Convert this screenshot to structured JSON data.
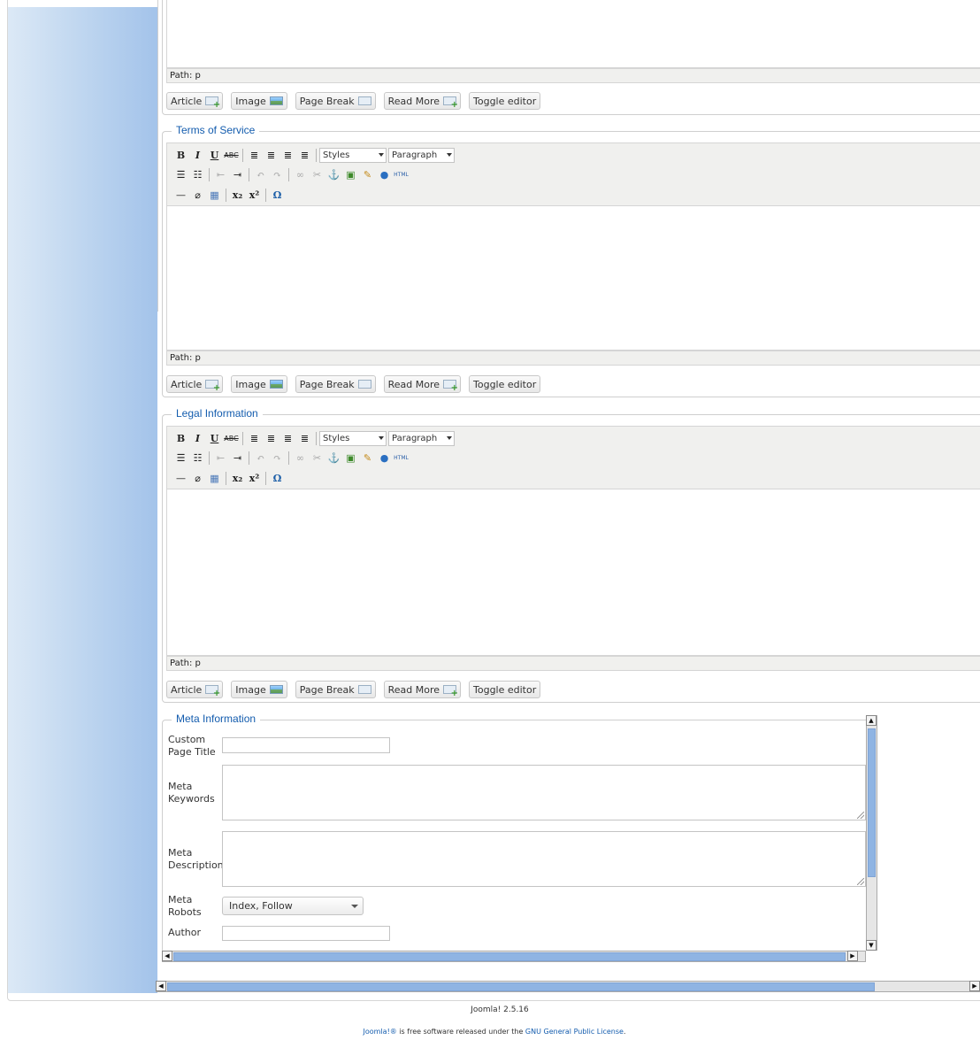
{
  "editor_buttons": {
    "article": "Article",
    "image": "Image",
    "page_break": "Page Break",
    "read_more": "Read More",
    "toggle_editor": "Toggle editor"
  },
  "toolbar": {
    "bold": "B",
    "italic": "I",
    "underline": "U",
    "strikethrough": "ABC",
    "styles_select": "Styles",
    "format_select": "Paragraph",
    "html_button": "HTML",
    "omega": "Ω"
  },
  "path_label": "Path: p",
  "sections": {
    "terms_of_service": "Terms of Service",
    "legal_information": "Legal Information",
    "meta_information": "Meta Information"
  },
  "meta": {
    "custom_page_title_line1": "Custom",
    "custom_page_title_line2": "Page Title",
    "meta_keywords_line1": "Meta",
    "meta_keywords_line2": "Keywords",
    "meta_description_line1": "Meta",
    "meta_description_line2": "Description",
    "meta_robots_line1": "Meta",
    "meta_robots_line2": "Robots",
    "meta_robots_value": "Index, Follow",
    "author_label": "Author"
  },
  "footer": {
    "version": "Joomla! 2.5.16",
    "license_link_joomla": "Joomla!®",
    "license_text": " is free software released under the ",
    "license_link_gpl": "GNU General Public License",
    "license_end": "."
  }
}
